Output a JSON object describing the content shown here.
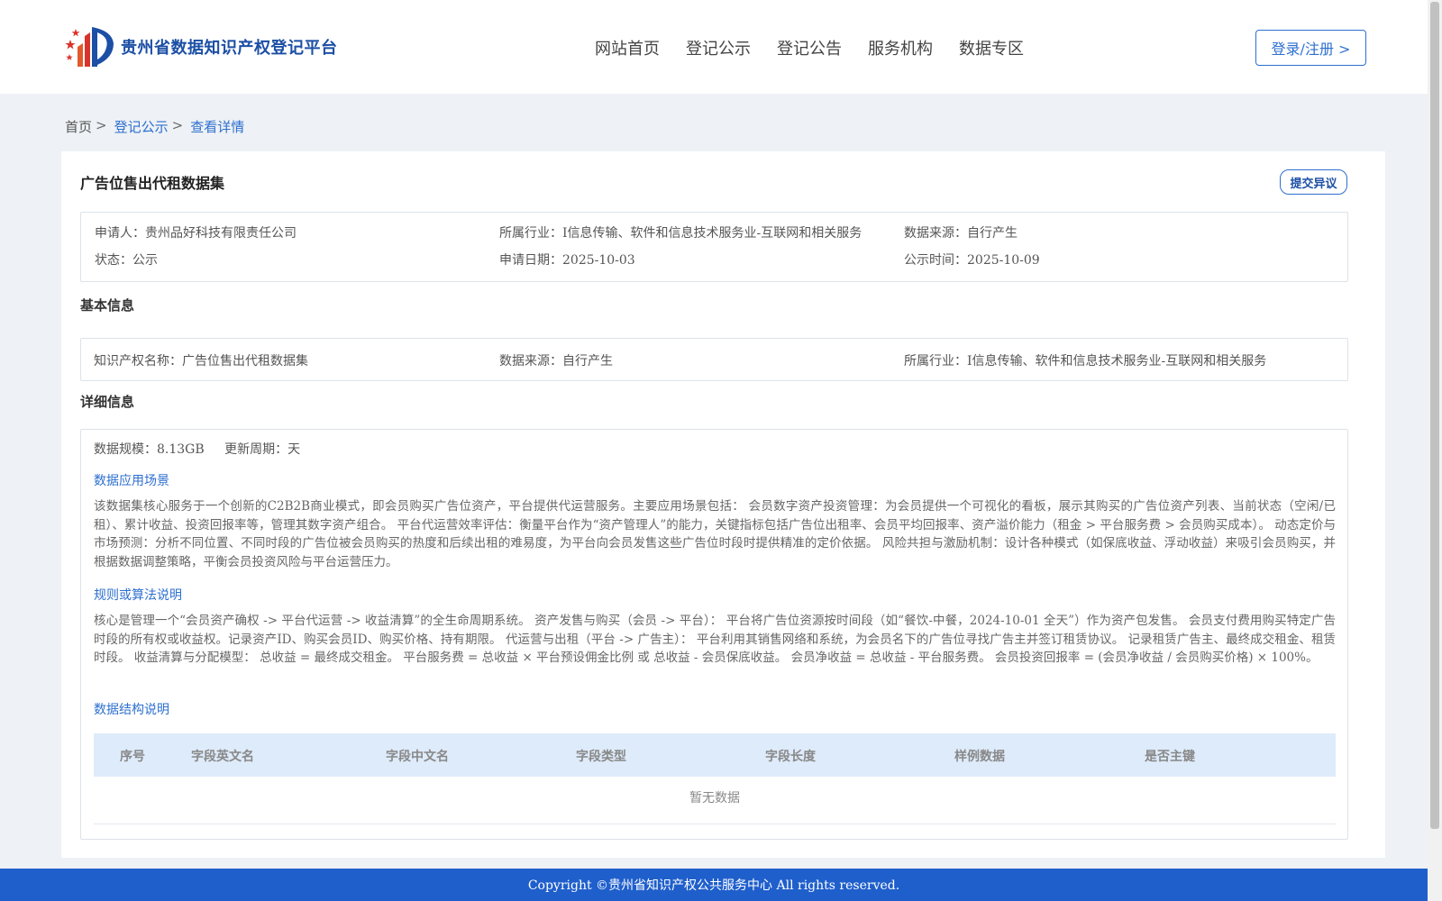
{
  "header": {
    "logo_text": "贵州省数据知识产权登记平台",
    "nav": [
      "网站首页",
      "登记公示",
      "登记公告",
      "服务机构",
      "数据专区"
    ],
    "login_label": "登录/注册 >"
  },
  "breadcrumb": {
    "home": "首页",
    "sep": ">",
    "items": [
      "登记公示",
      "查看详情"
    ]
  },
  "detail": {
    "title": "广告位售出代租数据集",
    "objection_label": "提交异议",
    "summary": [
      {
        "label": "申请人：",
        "value": "贵州品好科技有限责任公司"
      },
      {
        "label": "所属行业：",
        "value": "I信息传输、软件和信息技术服务业-互联网和相关服务"
      },
      {
        "label": "数据来源：",
        "value": "自行产生"
      },
      {
        "label": "状态：",
        "value": "公示"
      },
      {
        "label": "申请日期：",
        "value": "2025-10-03"
      },
      {
        "label": "公示时间：",
        "value": "2025-10-09"
      }
    ],
    "basic_title": "基本信息",
    "basic": [
      {
        "label": "知识产权名称：",
        "value": "广告位售出代租数据集"
      },
      {
        "label": "数据来源：",
        "value": "自行产生"
      },
      {
        "label": "所属行业：",
        "value": "I信息传输、软件和信息技术服务业-互联网和相关服务"
      }
    ],
    "detail_title": "详细信息",
    "scale_label": "数据规模：",
    "scale_value": "8.13GB",
    "cycle_label": "更新周期：",
    "cycle_value": "天",
    "scene_title": "数据应用场景",
    "scene_text": "该数据集核心服务于一个创新的C2B2B商业模式，即会员购买广告位资产，平台提供代运营服务。主要应用场景包括： 会员数字资产投资管理：为会员提供一个可视化的看板，展示其购买的广告位资产列表、当前状态（空闲/已租）、累计收益、投资回报率等，管理其数字资产组合。 平台代运营效率评估：衡量平台作为“资产管理人”的能力，关键指标包括广告位出租率、会员平均回报率、资产溢价能力（租金 > 平台服务费 > 会员购买成本）。 动态定价与市场预测：分析不同位置、不同时段的广告位被会员购买的热度和后续出租的难易度，为平台向会员发售这些广告位时段时提供精准的定价依据。 风险共担与激励机制：设计各种模式（如保底收益、浮动收益）来吸引会员购买，并根据数据调整策略，平衡会员投资风险与平台运营压力。",
    "rule_title": "规则或算法说明",
    "rule_text": "核心是管理一个“会员资产确权 -> 平台代运营 -> 收益清算”的全生命周期系统。 资产发售与购买（会员 -> 平台）： 平台将广告位资源按时间段（如“餐饮-中餐，2024-10-01 全天”）作为资产包发售。 会员支付费用购买特定广告时段的所有权或收益权。记录资产ID、购买会员ID、购买价格、持有期限。 代运营与出租（平台 -> 广告主）： 平台利用其销售网络和系统，为会员名下的广告位寻找广告主并签订租赁协议。 记录租赁广告主、最终成交租金、租赁时段。 收益清算与分配模型： 总收益 = 最终成交租金。 平台服务费 = 总收益 × 平台预设佣金比例 或 总收益 - 会员保底收益。 会员净收益 = 总收益 - 平台服务费。 会员投资回报率 = (会员净收益 / 会员购买价格) × 100%。",
    "struct_title": "数据结构说明",
    "table_headers": [
      "序号",
      "字段英文名",
      "字段中文名",
      "字段类型",
      "字段长度",
      "样例数据",
      "是否主键"
    ],
    "empty_text": "暂无数据"
  },
  "footer": {
    "copyright": "Copyright ©贵州省知识产权公共服务中心 All rights reserved."
  },
  "colors": {
    "brand_blue": "#1c4fa5",
    "link_blue": "#2d6fcf",
    "footer_blue": "#1f5fcc",
    "table_head_bg": "#deebfa",
    "page_bg": "#eef1f5"
  }
}
